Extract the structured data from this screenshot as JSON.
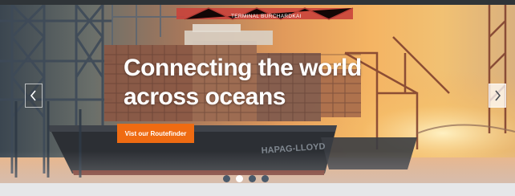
{
  "hero": {
    "headline_line1": "Connecting the world",
    "headline_line2": "across oceans",
    "cta_label": "Vist our Routefinder",
    "crane_sign": "TERMINAL BURCHARDKAI",
    "ship_name": "HAPAG-LLOYD",
    "cta_color": "#ef6b12"
  },
  "carousel": {
    "prev_icon": "chevron-left-icon",
    "next_icon": "chevron-right-icon",
    "slide_count": 4,
    "active_slide": 2
  }
}
